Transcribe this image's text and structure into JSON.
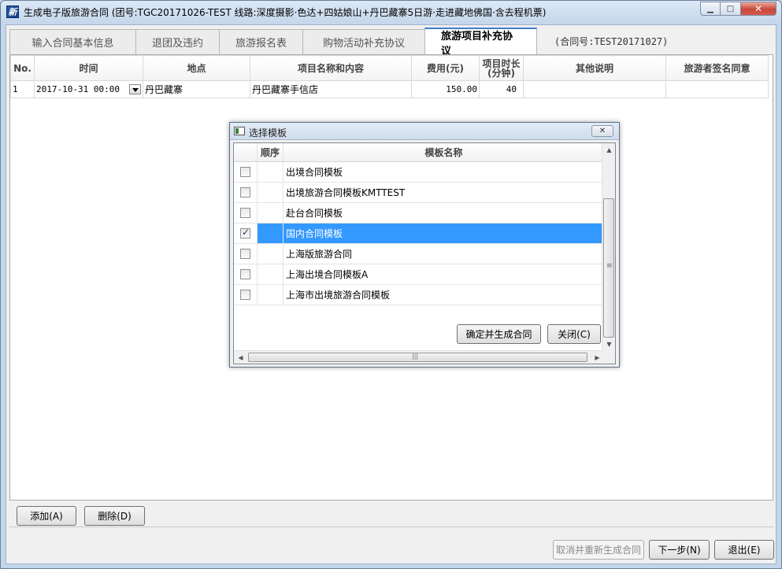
{
  "window": {
    "title": "生成电子版旅游合同 (团号:TGC20171026-TEST 线路:深度摄影·色达+四姑娘山+丹巴藏寨5日游·走进藏地佛国·含去程机票)",
    "app_icon_glyph": "新",
    "minimize": "▁",
    "maximize": "□",
    "close": "✕"
  },
  "tabs": [
    {
      "label": "输入合同基本信息"
    },
    {
      "label": "退团及违约"
    },
    {
      "label": "旅游报名表"
    },
    {
      "label": "购物活动补充协议"
    },
    {
      "label": "旅游项目补充协议"
    }
  ],
  "contract_no": "(合同号:TEST20171027)",
  "grid": {
    "headers": {
      "no": "No.",
      "time": "时间",
      "place": "地点",
      "item": "项目名称和内容",
      "fee": "费用(元)",
      "duration": "项目时长(分钟)",
      "notes": "其他说明",
      "sign": "旅游者签名同意"
    },
    "rows": [
      {
        "no": "1",
        "time": "2017-10-31 00:00",
        "place": "丹巴藏寨",
        "item": "丹巴藏寨手信店",
        "fee": "150.00",
        "duration": "40",
        "notes": "",
        "sign": ""
      }
    ]
  },
  "buttons": {
    "add": "添加(A)",
    "delete": "删除(D)",
    "cancel_regen": "取消并重新生成合同",
    "next": "下一步(N)",
    "exit": "退出(E)"
  },
  "dialog": {
    "title": "选择模板",
    "close": "✕",
    "headers": {
      "order": "顺序",
      "name": "模板名称"
    },
    "items": [
      {
        "name": "出境合同模板",
        "checked": false
      },
      {
        "name": "出境旅游合同模板KMTTEST",
        "checked": false
      },
      {
        "name": "赴台合同模板",
        "checked": false
      },
      {
        "name": "国内合同模板",
        "checked": true
      },
      {
        "name": "上海版旅游合同",
        "checked": false
      },
      {
        "name": "上海出境合同模板A",
        "checked": false
      },
      {
        "name": "上海市出境旅游合同模板",
        "checked": false
      }
    ],
    "confirm": "确定并生成合同",
    "close_btn": "关闭(C)"
  }
}
